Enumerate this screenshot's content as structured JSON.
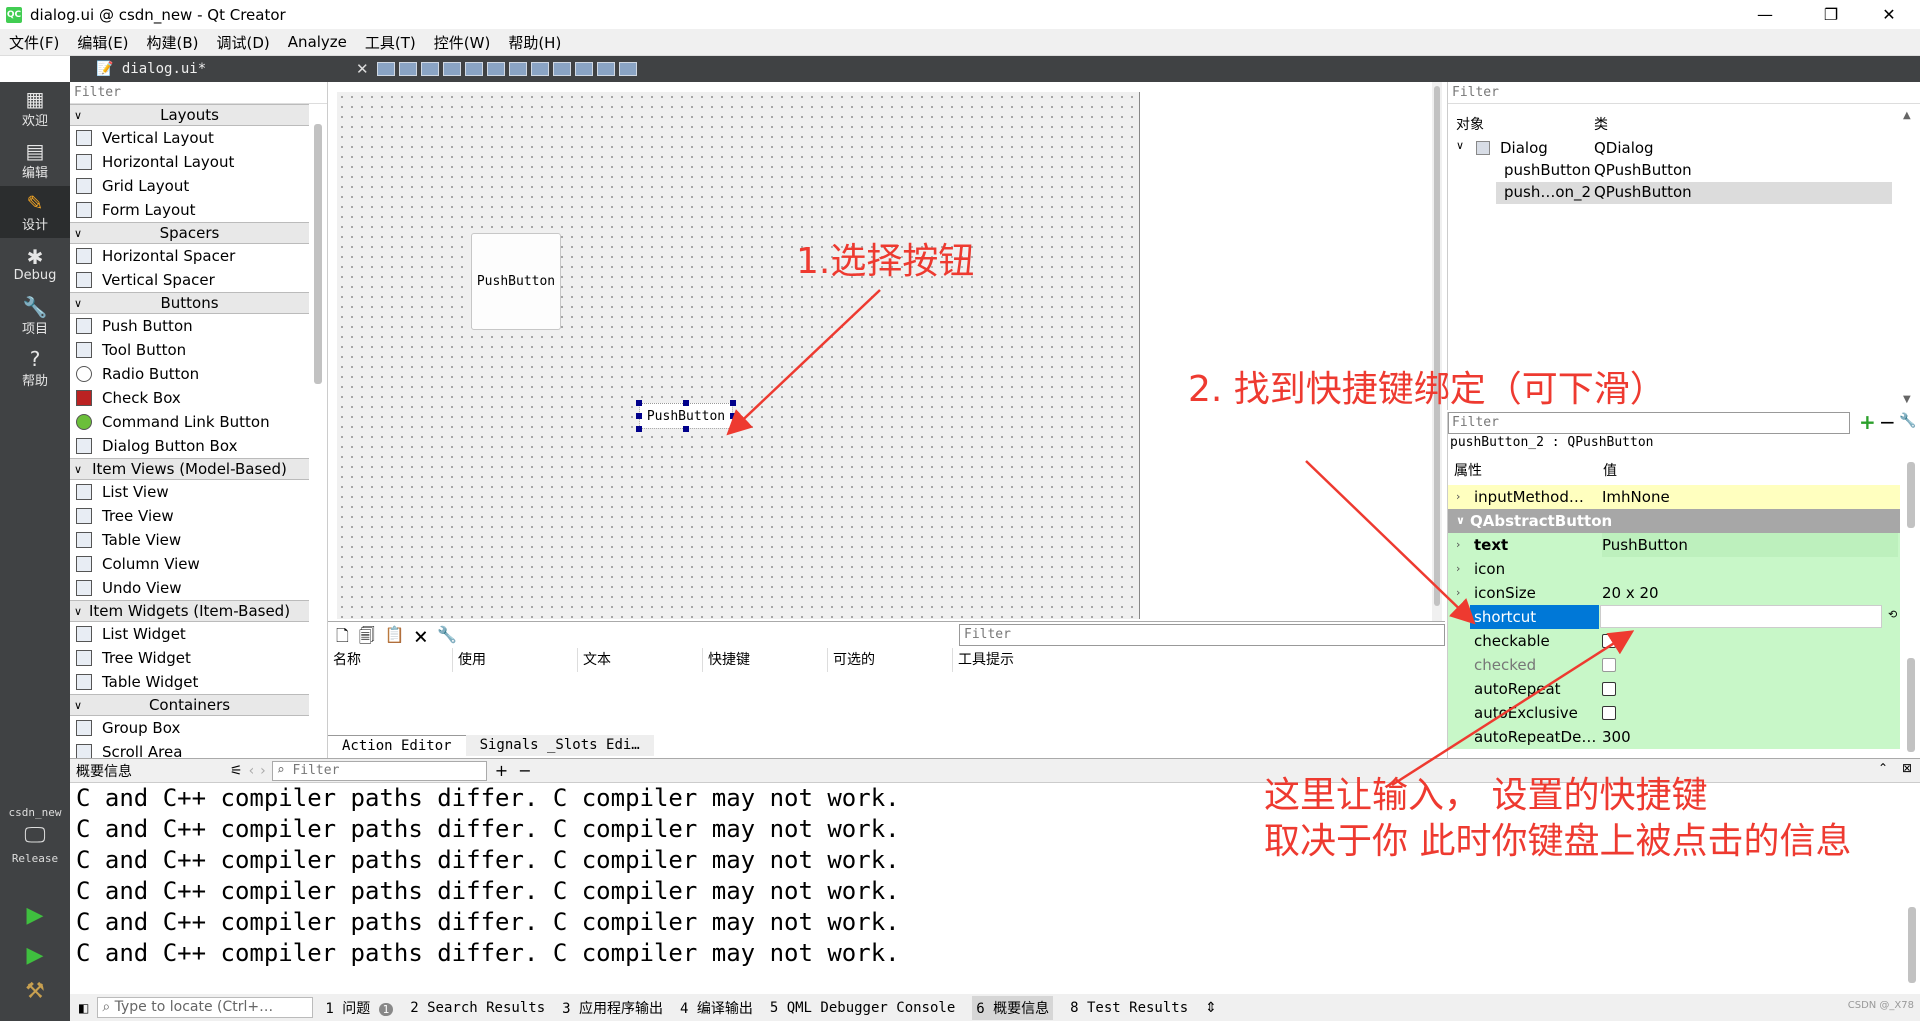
{
  "window": {
    "title": "dialog.ui @ csdn_new - Qt Creator",
    "app_icon": "QC",
    "min": "—",
    "max": "❐",
    "close": "✕"
  },
  "menu": [
    "文件(F)",
    "编辑(E)",
    "构建(B)",
    "调试(D)",
    "Analyze",
    "工具(T)",
    "控件(W)",
    "帮助(H)"
  ],
  "modes": [
    {
      "label": "欢迎",
      "icon": "grid-icon"
    },
    {
      "label": "编辑",
      "icon": "edit-icon"
    },
    {
      "label": "设计",
      "icon": "pencil-icon"
    },
    {
      "label": "Debug",
      "icon": "bug-icon"
    },
    {
      "label": "项目",
      "icon": "wrench-icon"
    },
    {
      "label": "帮助",
      "icon": "help-icon"
    }
  ],
  "kit": {
    "project": "csdn_new",
    "config": "Release"
  },
  "toolbar": {
    "document": "dialog.ui*"
  },
  "widgetbox": {
    "filter": "Filter",
    "sections": [
      {
        "name": "Layouts",
        "items": [
          "Vertical Layout",
          "Horizontal Layout",
          "Grid Layout",
          "Form Layout"
        ]
      },
      {
        "name": "Spacers",
        "items": [
          "Horizontal Spacer",
          "Vertical Spacer"
        ]
      },
      {
        "name": "Buttons",
        "items": [
          "Push Button",
          "Tool Button",
          "Radio Button",
          "Check Box",
          "Command Link Button",
          "Dialog Button Box"
        ]
      },
      {
        "name": "Item Views (Model-Based)",
        "items": [
          "List View",
          "Tree View",
          "Table View",
          "Column View",
          "Undo View"
        ]
      },
      {
        "name": "Item Widgets (Item-Based)",
        "items": [
          "List Widget",
          "Tree Widget",
          "Table Widget"
        ]
      },
      {
        "name": "Containers",
        "items": [
          "Group Box",
          "Scroll Area"
        ]
      }
    ]
  },
  "form": {
    "button1": "PushButton",
    "button2": "PushButton"
  },
  "action_editor": {
    "filter": "Filter",
    "columns": [
      "名称",
      "使用",
      "文本",
      "快捷键",
      "可选的",
      "工具提示"
    ],
    "tabs": [
      "Action Editor",
      "Signals _Slots Edi…"
    ]
  },
  "object_inspector": {
    "filter": "Filter",
    "col_object": "对象",
    "col_class": "类",
    "rows": [
      {
        "name": "Dialog",
        "class": "QDialog"
      },
      {
        "name": "pushButton",
        "class": "QPushButton"
      },
      {
        "name": "push…on_2",
        "class": "QPushButton"
      }
    ]
  },
  "property_editor": {
    "filter": "Filter",
    "context": "pushButton_2 : QPushButton",
    "col_prop": "属性",
    "col_value": "值",
    "rows": [
      {
        "name": "inputMethod…",
        "value": "ImhNone"
      },
      {
        "name": "QAbstractButton",
        "value": ""
      },
      {
        "name": "text",
        "value": "PushButton"
      },
      {
        "name": "icon",
        "value": ""
      },
      {
        "name": "iconSize",
        "value": "20 x 20"
      },
      {
        "name": "shortcut",
        "value": ""
      },
      {
        "name": "checkable",
        "value": ""
      },
      {
        "name": "checked",
        "value": ""
      },
      {
        "name": "autoRepeat",
        "value": ""
      },
      {
        "name": "autoExclusive",
        "value": ""
      },
      {
        "name": "autoRepeatDe…",
        "value": "300"
      }
    ]
  },
  "output": {
    "title": "概要信息",
    "filter": "Filter",
    "lines": [
      "C and C++ compiler paths differ. C compiler may not work.",
      "C and C++ compiler paths differ. C compiler may not work.",
      "C and C++ compiler paths differ. C compiler may not work.",
      "C and C++ compiler paths differ. C compiler may not work.",
      "C and C++ compiler paths differ. C compiler may not work.",
      "C and C++ compiler paths differ. C compiler may not work."
    ]
  },
  "status": {
    "locator": "Type to locate (Ctrl+…",
    "panes": [
      "1 问题",
      "2 Search Results",
      "3 应用程序输出",
      "4 编译输出",
      "5 QML Debugger Console",
      "6 概要信息",
      "8 Test Results"
    ],
    "issues_badge": "1",
    "watermark": "CSDN @_X78"
  },
  "annotations": {
    "step1": "1.选择按钮",
    "step2": "2. 找到快捷键绑定（可下滑）",
    "note_line1": "这里让输入，  设置的快捷键",
    "note_line2": "取决于你 此时你键盘上被点击的信息",
    "color": "#ee3a30"
  },
  "colors": {
    "sidebar": "#404244",
    "prop_yellow": "#ffffbf",
    "prop_green": "#c8f7c8",
    "prop_header": "#a7a7a7",
    "selection": "#0078d7"
  }
}
